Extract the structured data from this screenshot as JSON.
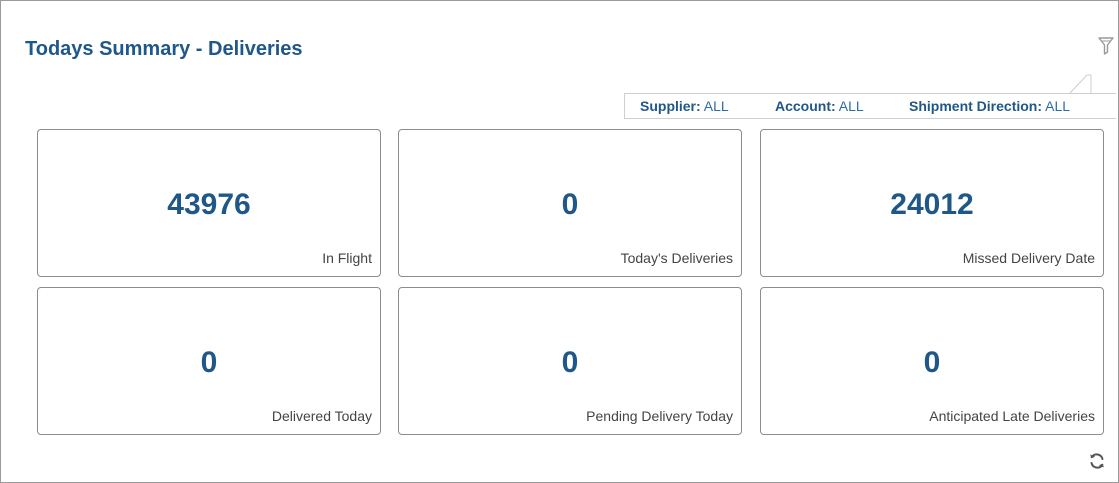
{
  "widget": {
    "title": "Todays Summary - Deliveries",
    "filter_icon": "funnel-icon",
    "refresh_icon": "refresh-icon"
  },
  "filters": [
    {
      "label": "Supplier:",
      "value": "ALL"
    },
    {
      "label": "Account:",
      "value": "ALL"
    },
    {
      "label": "Shipment Direction:",
      "value": "ALL"
    }
  ],
  "cards": [
    {
      "value": "43976",
      "label": "In Flight"
    },
    {
      "value": "0",
      "label": "Today's Deliveries"
    },
    {
      "value": "24012",
      "label": "Missed Delivery Date"
    },
    {
      "value": "0",
      "label": "Delivered Today"
    },
    {
      "value": "0",
      "label": "Pending Delivery Today"
    },
    {
      "value": "0",
      "label": "Anticipated Late Deliveries"
    }
  ],
  "colors": {
    "accent": "#1f5789",
    "link": "#2e6da4",
    "border": "#8c8c8c"
  }
}
